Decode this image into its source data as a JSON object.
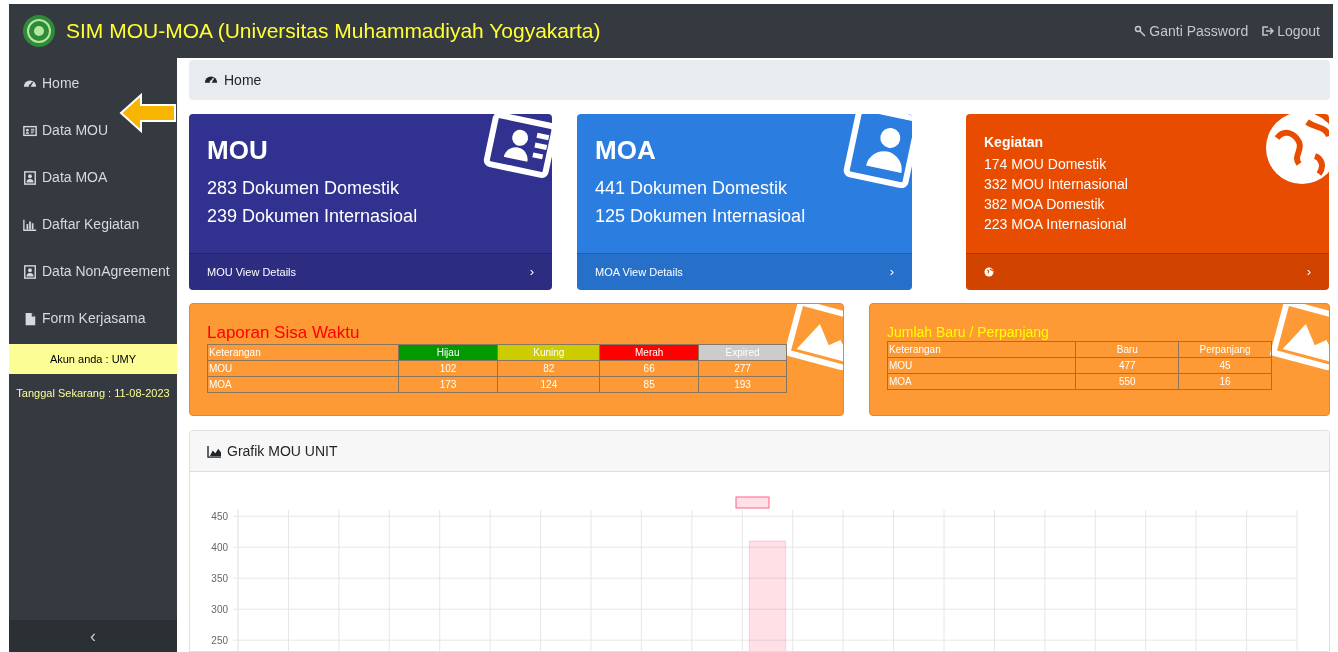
{
  "header": {
    "title": "SIM MOU-MOA (Universitas Muhammadiyah Yogyakarta)",
    "links": [
      "Ganti Password",
      "Logout"
    ]
  },
  "sidebar": {
    "items": [
      {
        "label": "Home"
      },
      {
        "label": "Data MOU"
      },
      {
        "label": "Data MOA"
      },
      {
        "label": "Daftar Kegiatan"
      },
      {
        "label": "Data NonAgreement"
      },
      {
        "label": "Form Kerjasama"
      }
    ],
    "account": "Akun anda : UMY",
    "date": "Tanggal Sekarang : 11-08-2023",
    "collapse": "‹"
  },
  "breadcrumb": "Home",
  "cards": [
    {
      "kind": "big",
      "title": "MOU",
      "lines": [
        "283 Dokumen Domestik",
        "239 Dokumen Internasioal"
      ],
      "footer": "MOU View Details",
      "chevron": "›",
      "color": "#31318f"
    },
    {
      "kind": "big",
      "title": "MOA",
      "lines": [
        "441 Dokumen Domestik",
        "125 Dokumen Internasioal"
      ],
      "footer": "MOA View Details",
      "chevron": "›",
      "color": "#2b7de0"
    },
    {
      "kind": "small",
      "title": "Kegiatan",
      "lines": [
        "174 MOU Domestik",
        "332 MOU Internasional",
        "382 MOA Domestik",
        "223 MOA Internasional"
      ],
      "chevron": "›",
      "color": "#e84c00"
    }
  ],
  "reports": [
    {
      "title": "Laporan Sisa Waktu",
      "columns": [
        {
          "label": "Keterangan"
        },
        {
          "label": "Hijau",
          "color": "#009900"
        },
        {
          "label": "Kuning",
          "color": "#cccc00"
        },
        {
          "label": "Merah",
          "color": "#ff0000"
        },
        {
          "label": "Expired",
          "color": "#cccccc"
        }
      ],
      "rows": [
        [
          "MOU",
          "102",
          "82",
          "66",
          "277"
        ],
        [
          "MOA",
          "173",
          "124",
          "85",
          "193"
        ]
      ]
    },
    {
      "title": "Jumlah Baru / Perpanjang",
      "columns": [
        {
          "label": "Keterangan"
        },
        {
          "label": "Baru"
        },
        {
          "label": "Perpanjang"
        }
      ],
      "rows": [
        [
          "MOU",
          "477",
          "45"
        ],
        [
          "MOA",
          "550",
          "16"
        ]
      ]
    }
  ],
  "chart_panel": {
    "title": "Grafik MOU UNIT",
    "chart_data": {
      "type": "bar",
      "series": [
        {
          "color": "#ff6384",
          "values": [
            null,
            null,
            null,
            null,
            null,
            null,
            null,
            null,
            null,
            null,
            410,
            null,
            null,
            null,
            null,
            null,
            null,
            null,
            null,
            null,
            null
          ]
        }
      ],
      "ylim": [
        230,
        460
      ],
      "grid": true,
      "yticks": [
        250,
        300,
        350,
        400,
        450
      ]
    }
  }
}
